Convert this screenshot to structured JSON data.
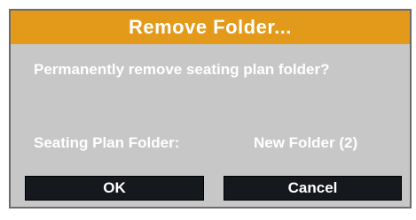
{
  "dialog": {
    "title": "Remove Folder...",
    "message": "Permanently remove seating plan folder?",
    "field_label": "Seating Plan Folder:",
    "field_value": "New Folder (2)",
    "ok_label": "OK",
    "cancel_label": "Cancel"
  },
  "colors": {
    "titlebar": "#e39a1b",
    "background": "#c7c7c7",
    "button": "#15181c",
    "text": "#ffffff"
  }
}
